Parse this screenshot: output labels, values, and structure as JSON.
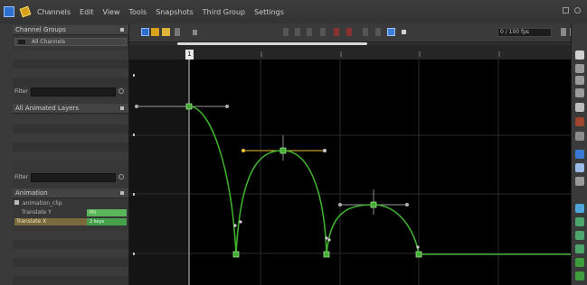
{
  "menu": {
    "items": [
      "Channels",
      "Edit",
      "View",
      "Tools",
      "Snapshots",
      "Third Group",
      "Settings"
    ]
  },
  "left_panel": {
    "header_top": "Channel Groups",
    "track_label": "All Channels",
    "search_label_1": "Filter",
    "section2_header": "All Animated Layers",
    "search_label_2": "Filter",
    "section3_header": "Animation",
    "anim_item_label": "animation_clip",
    "track_name_1": "Translate Y",
    "track_name_2": "Translate X",
    "pill_1": "Pill",
    "pill_2": "2 keys"
  },
  "toolbar": {
    "frame_display": "0 / 100 fps"
  },
  "ruler": {
    "current_frame": "1"
  },
  "colors": {
    "curve": "#3fae2f",
    "tangent": "#9a9a9a",
    "selected_tangent": "#f2c232",
    "grid": "#2c2c2c",
    "accent_blue": "#2f6fd0"
  },
  "icons": {
    "app": "app-icon",
    "pencil": "pencil-icon",
    "minimize": "minimize-icon",
    "close": "close-icon"
  }
}
